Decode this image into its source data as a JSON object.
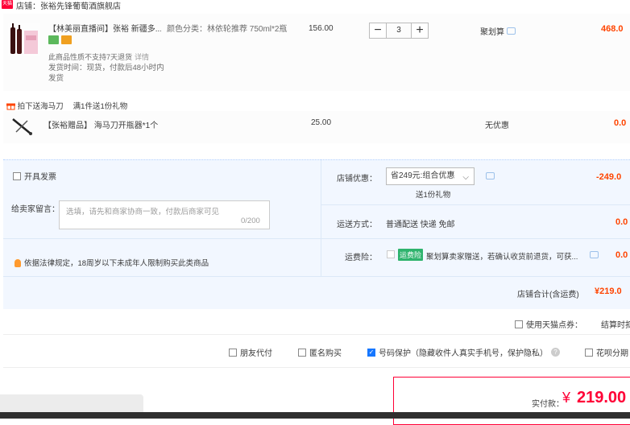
{
  "shop": {
    "badge": "天猫",
    "name": "店铺：张裕先锋葡萄酒旗舰店"
  },
  "item": {
    "title": "【林美丽直播间】张裕 新疆多...",
    "note": "此商品性质不支持7天退货",
    "note_link": "详情",
    "ship_time": "发货时间：现货，付款后48小时内发货",
    "spec": "颜色分类：林依轮推荐 750ml*2瓶",
    "unit_price": "156.00",
    "qty_minus": "−",
    "qty": "3",
    "qty_plus": "+",
    "discount_type": "聚划算",
    "total": "468.0"
  },
  "gift": {
    "head": "拍下送海马刀",
    "head_rule": "满1件送1份礼物",
    "title": "【张裕赠品】 海马刀开瓶器*1个",
    "price": "25.00",
    "discount": "无优惠",
    "total": "0.0"
  },
  "invoice": {
    "label": "开具发票"
  },
  "message": {
    "label": "给卖家留言：",
    "placeholder": "选填，请先和商家协商一致，付款后商家可见",
    "count": "0/200"
  },
  "legal": {
    "text": "依据法律规定，18周岁以下未成年人限制购买此类商品"
  },
  "shop_discount": {
    "label": "店铺优惠：",
    "selected": "省249元:组合优惠",
    "gift": "送1份礼物",
    "value": "-249.0"
  },
  "shipping": {
    "label": "运送方式：",
    "method": "普通配送 快递 免邮",
    "value": "0.0"
  },
  "insurance": {
    "label": "运费险：",
    "badge": "运费险",
    "text": "聚划算卖家赠送，若确认收货前退货，可获...",
    "value": "0.0"
  },
  "shop_total": {
    "label": "店铺合计(含运费)",
    "value": "¥219.0"
  },
  "points": {
    "label": "使用天猫点券：",
    "right": "结算时扣"
  },
  "options": [
    {
      "label": "朋友代付",
      "checked": false
    },
    {
      "label": "匿名购买",
      "checked": false
    },
    {
      "label": "号码保护（隐藏收件人真实手机号，保护隐私）",
      "checked": true
    },
    {
      "label": "花呗分期",
      "checked": false
    }
  ],
  "payment": {
    "label": "实付款：",
    "currency": "¥",
    "value": "219.00"
  },
  "colors": {
    "accent": "#ff4400",
    "pay": "#ff0036",
    "panel": "#f2f7ff",
    "check": "#1677ff"
  }
}
